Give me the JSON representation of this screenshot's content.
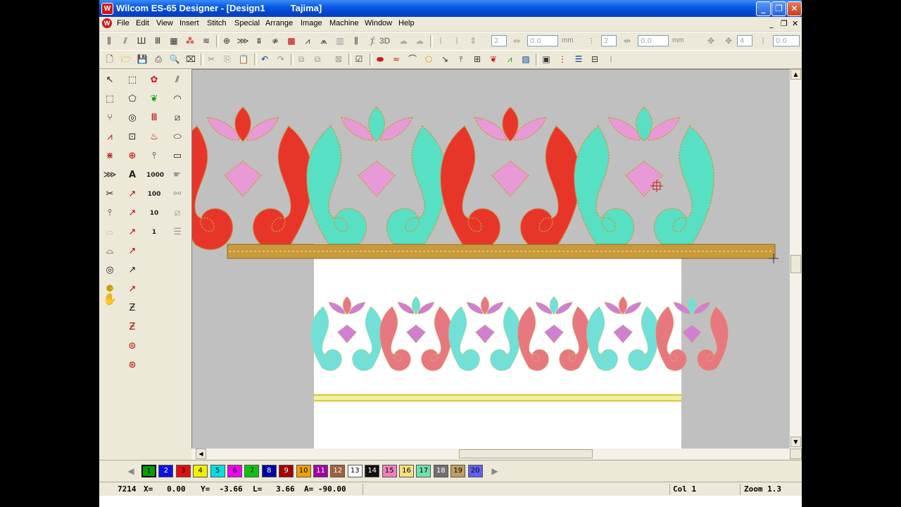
{
  "window": {
    "title": "Wilcom ES-65 Designer - [Design1          Tajima]",
    "logo_letter": "W",
    "controls": {
      "minimize": "_",
      "maximize": "❐",
      "close": "✕"
    }
  },
  "menu": {
    "items": [
      "File",
      "Edit",
      "View",
      "Insert",
      "Stitch",
      "Special",
      "Arrange",
      "Image",
      "Machine",
      "Window",
      "Help"
    ],
    "mdi_controls": {
      "minimize": "_",
      "restore": "❐",
      "close": "✕"
    }
  },
  "toolbar_top": {
    "spin1_value": "2",
    "spin2_value": "0.0",
    "spin2_unit": "mm",
    "spin3_value": "2",
    "spin4_value": "0.0",
    "spin4_unit": "mm",
    "spin5_value": "4",
    "spin6_value": "0.0",
    "label_3d": "3D"
  },
  "left_tools_text": {
    "lettering": "A",
    "count_1000": "1000",
    "count_100": "100",
    "count_10": "10",
    "count_1": "1"
  },
  "palette": {
    "colors": [
      {
        "n": "1",
        "c": "#00a000"
      },
      {
        "n": "2",
        "c": "#1010e0"
      },
      {
        "n": "3",
        "c": "#e01010"
      },
      {
        "n": "4",
        "c": "#f0f000"
      },
      {
        "n": "5",
        "c": "#00e0e0"
      },
      {
        "n": "6",
        "c": "#f000f0"
      },
      {
        "n": "7",
        "c": "#10c010"
      },
      {
        "n": "8",
        "c": "#0000a0"
      },
      {
        "n": "9",
        "c": "#a00000"
      },
      {
        "n": "10",
        "c": "#f0a000"
      },
      {
        "n": "11",
        "c": "#a000a0"
      },
      {
        "n": "12",
        "c": "#a06040"
      },
      {
        "n": "13",
        "c": "#ffffff"
      },
      {
        "n": "14",
        "c": "#101010"
      },
      {
        "n": "15",
        "c": "#f080c0"
      },
      {
        "n": "16",
        "c": "#f8e080"
      },
      {
        "n": "17",
        "c": "#70e0b0"
      },
      {
        "n": "18",
        "c": "#707070"
      },
      {
        "n": "19",
        "c": "#c0a060"
      },
      {
        "n": "20",
        "c": "#6060f0"
      }
    ],
    "active": "1"
  },
  "status": {
    "stitch_count": "7214",
    "x": "X=   0.00",
    "y": "Y=  -3.66",
    "l": "L=   3.66",
    "a": "A= -90.00",
    "col": "Col 1",
    "zoom": "Zoom 1.3"
  },
  "design_colors": {
    "red": "#e8352a",
    "pink": "#e89ad8",
    "teal": "#58e0c4",
    "gold": "#c89a3c",
    "salmon": "#e87880",
    "light_teal": "#70e0d8",
    "light_pink": "#d080d0",
    "cream": "#f4f0a0"
  }
}
